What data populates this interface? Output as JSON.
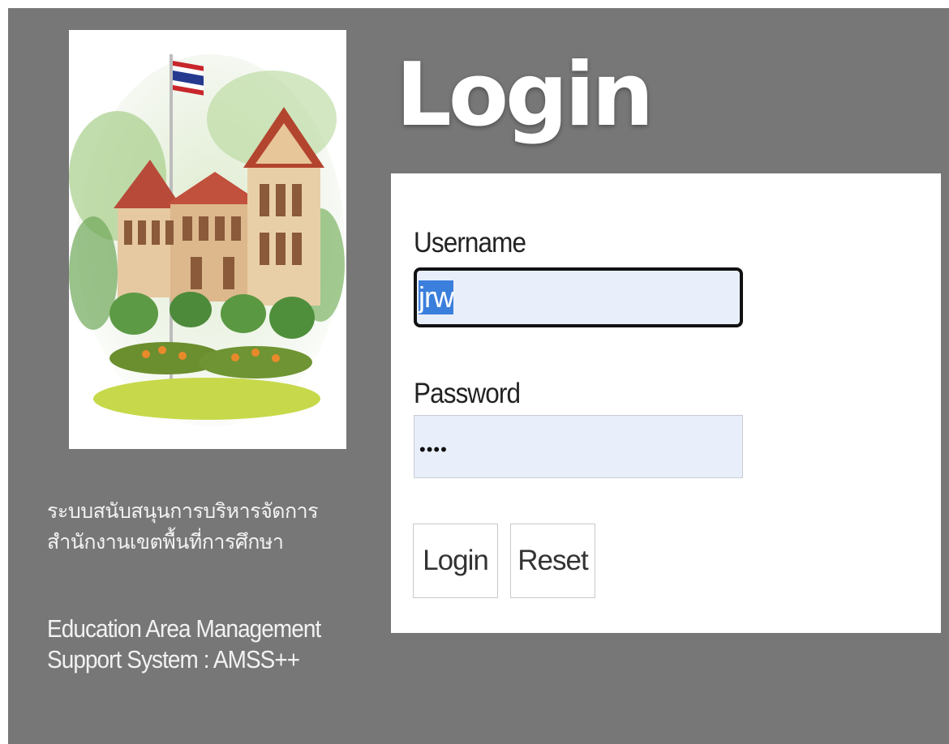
{
  "header": {
    "title": "Login"
  },
  "branding": {
    "logo_icon": "school-building-with-thai-flag-icon",
    "org_name_thai": [
      "ระบบสนับสนุนการบริหารจัดการ",
      "สำนักงานเขตพื้นที่การศึกษา"
    ],
    "org_name_english": [
      "Education Area Management",
      "Support System : AMSS++"
    ]
  },
  "form": {
    "username_label": "Username",
    "username_value": "jrw",
    "password_label": "Password",
    "password_value": "••••",
    "login_button": "Login",
    "reset_button": "Reset"
  },
  "colors": {
    "page_background": "#777777",
    "panel_background": "#ffffff",
    "input_background": "#e8effa",
    "selection_highlight": "#3b7fdd"
  }
}
